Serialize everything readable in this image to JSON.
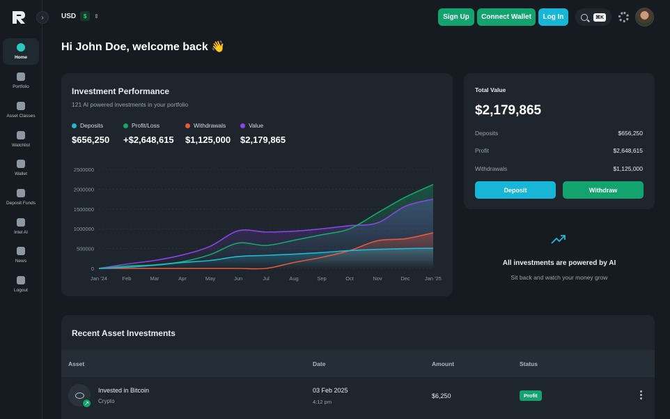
{
  "header": {
    "currency": "USD",
    "currency_symbol": "$",
    "signup_label": "Sign Up",
    "connect_label": "Connect Wallet",
    "login_label": "Log In",
    "shortcut": "⌘K"
  },
  "greeting": "Hi John Doe, welcome back 👋",
  "sidebar": {
    "items": [
      {
        "label": "Home",
        "icon": "home-icon"
      },
      {
        "label": "Portfolio",
        "icon": "portfolio-icon"
      },
      {
        "label": "Asset Classes",
        "icon": "asset-classes-icon"
      },
      {
        "label": "Watchlist",
        "icon": "watchlist-icon"
      },
      {
        "label": "Wallet",
        "icon": "wallet-icon"
      },
      {
        "label": "Deposit Funds",
        "icon": "deposit-funds-icon"
      },
      {
        "label": "Intel AI",
        "icon": "intel-ai-icon"
      },
      {
        "label": "News",
        "icon": "news-icon"
      },
      {
        "label": "Logout",
        "icon": "logout-icon"
      }
    ]
  },
  "performance": {
    "title": "Investment Performance",
    "subtitle": "121 AI powered investments in your portfolio",
    "legend": [
      {
        "label": "Deposits",
        "value": "$656,250",
        "color": "#22b8d4"
      },
      {
        "label": "Profit/Loss",
        "value": "+$2,648,615",
        "color": "#15a86a"
      },
      {
        "label": "Withdrawals",
        "value": "$1,125,000",
        "color": "#e8583c"
      },
      {
        "label": "Value",
        "value": "$2,179,865",
        "color": "#8a44e8"
      }
    ]
  },
  "chart_data": {
    "type": "area",
    "categories": [
      "Jan '24",
      "Feb",
      "Mar",
      "Apr",
      "May",
      "Jun",
      "Jul",
      "Aug",
      "Sep",
      "Oct",
      "Nov",
      "Dec",
      "Jan '25"
    ],
    "yticks": [
      0,
      500000,
      1000000,
      1500000,
      2000000,
      2500000
    ],
    "ylim": [
      0,
      2500000
    ],
    "series": [
      {
        "name": "Deposits",
        "color": "#22b8d4",
        "values": [
          0,
          30000,
          80000,
          150000,
          200000,
          300000,
          330000,
          360000,
          400000,
          450000,
          480000,
          500000,
          510000
        ]
      },
      {
        "name": "Profit/Loss",
        "color": "#15a86a",
        "values": [
          0,
          60000,
          90000,
          170000,
          350000,
          640000,
          580000,
          710000,
          850000,
          1000000,
          1400000,
          1800000,
          2120000
        ]
      },
      {
        "name": "Withdrawals",
        "color": "#e8583c",
        "values": [
          0,
          0,
          0,
          0,
          0,
          0,
          0,
          150000,
          280000,
          450000,
          700000,
          750000,
          900000
        ]
      },
      {
        "name": "Value",
        "color": "#8a44e8",
        "values": [
          0,
          110000,
          200000,
          340000,
          560000,
          950000,
          920000,
          940000,
          1000000,
          1080000,
          1150000,
          1570000,
          1750000
        ]
      }
    ]
  },
  "total": {
    "label": "Total Value",
    "value": "$2,179,865",
    "rows": [
      {
        "label": "Deposits",
        "value": "$656,250"
      },
      {
        "label": "Profit",
        "value": "$2,648,615"
      },
      {
        "label": "Withdrawals",
        "value": "$1,125,000"
      }
    ],
    "deposit_label": "Deposit",
    "withdraw_label": "Withdraw"
  },
  "ai_promo": {
    "title": "All investments are powered by AI",
    "subtitle": "Sit back and watch your money grow"
  },
  "recent": {
    "title": "Recent Asset Investments",
    "columns": [
      "Asset",
      "Date",
      "Amount",
      "Status"
    ],
    "rows": [
      {
        "asset": "Invested in Bitcoin",
        "asset_class": "Crypto",
        "date": "03 Feb 2025",
        "time": "4:12 pm",
        "amount": "$6,250",
        "status": "Profit"
      }
    ]
  }
}
